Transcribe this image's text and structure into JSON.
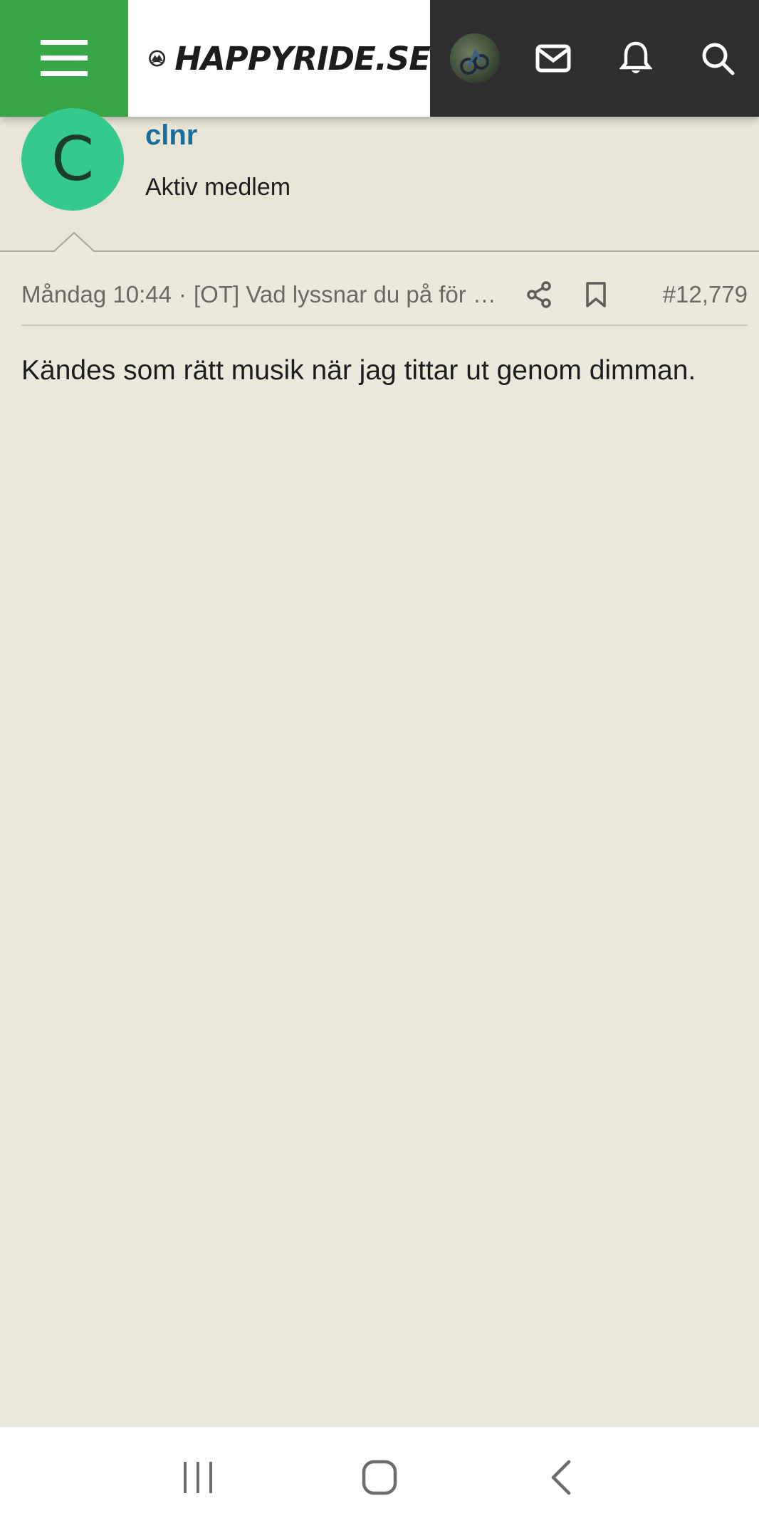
{
  "header": {
    "menu_icon": "hamburger-icon",
    "logo_text": "HAPPYRIDE.SE",
    "avatar_icon": "user-avatar",
    "mail_icon": "envelope-icon",
    "bell_icon": "bell-icon",
    "search_icon": "search-icon",
    "brand_green": "#37a646",
    "bar_dark": "#2f2f2f"
  },
  "post": {
    "avatar_letter": "C",
    "avatar_color": "#35c98e",
    "author_name": "clnr",
    "author_title": "Aktiv medlem",
    "date": "Måndag 10:44",
    "separator": "·",
    "thread_title": "[OT] Vad lyssnar du på för musik?",
    "share_icon": "share-icon",
    "bookmark_icon": "bookmark-icon",
    "post_number": "#12,779",
    "body": "Kändes som rätt musik när jag tittar ut genom dimman."
  },
  "system_nav": {
    "recents_icon": "recents-icon",
    "home_icon": "home-icon",
    "back_icon": "back-icon"
  }
}
